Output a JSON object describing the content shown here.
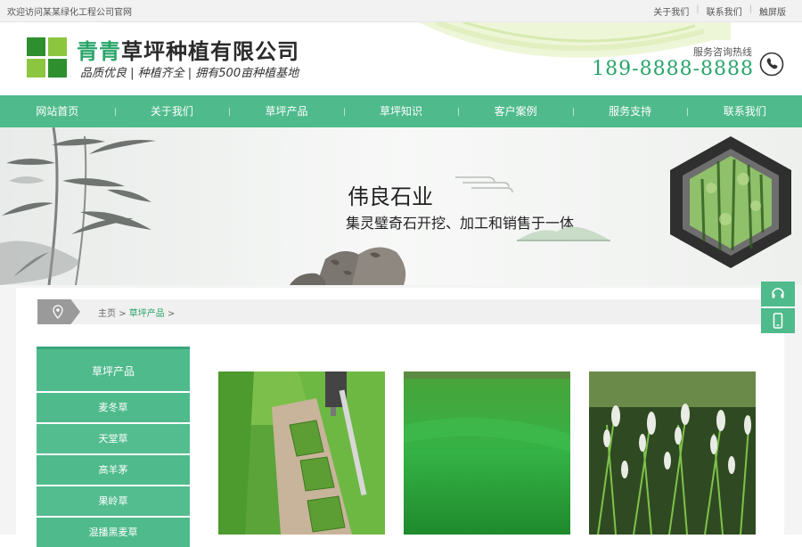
{
  "topbar": {
    "welcome": "欢迎访问某某绿化工程公司官网",
    "links": [
      "关于我们",
      "联系我们",
      "触屏版"
    ]
  },
  "header": {
    "company_accent": "青青",
    "company_rest": "草坪种植有限公司",
    "slogan": "品质优良 | 种植齐全 | 拥有500亩种植基地",
    "hotline_label": "服务咨询热线",
    "hotline_number": "189-8888-8888",
    "logo_icon": "four-square-logo-icon",
    "phone_icon": "phone-icon"
  },
  "nav": {
    "items": [
      "网站首页",
      "关于我们",
      "草坪产品",
      "草坪知识",
      "客户案例",
      "服务支持",
      "联系我们"
    ]
  },
  "banner": {
    "title": "伟良石业",
    "subtitle": "集灵璧奇石开挖、加工和销售于一体"
  },
  "floating": {
    "icons": [
      "headset-icon",
      "mobile-icon"
    ]
  },
  "breadcrumb": {
    "home": "主页",
    "sep": ">",
    "current": "草坪产品",
    "trail_end": ">"
  },
  "sidebar": {
    "title": "草坪产品",
    "items": [
      "麦冬草",
      "天堂草",
      "高羊茅",
      "果岭草",
      "混播黑麦草"
    ]
  },
  "colors": {
    "brand_green": "#4fba8c",
    "text_green": "#2aa56a",
    "logo_green_dark": "#2d8f2d",
    "logo_green_light": "#8cc63f"
  }
}
